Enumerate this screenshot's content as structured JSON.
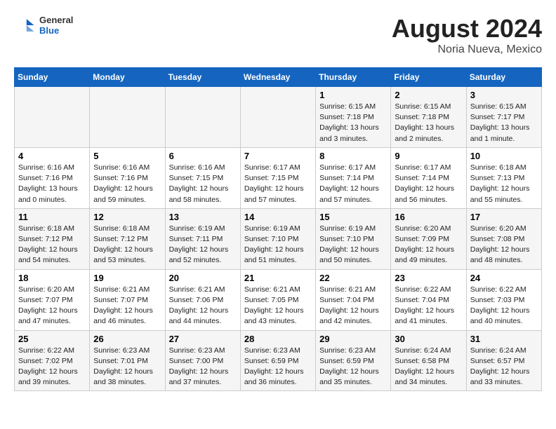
{
  "header": {
    "logo_general": "General",
    "logo_blue": "Blue",
    "title": "August 2024",
    "subtitle": "Noria Nueva, Mexico"
  },
  "weekdays": [
    "Sunday",
    "Monday",
    "Tuesday",
    "Wednesday",
    "Thursday",
    "Friday",
    "Saturday"
  ],
  "weeks": [
    [
      {
        "day": "",
        "content": ""
      },
      {
        "day": "",
        "content": ""
      },
      {
        "day": "",
        "content": ""
      },
      {
        "day": "",
        "content": ""
      },
      {
        "day": "1",
        "content": "Sunrise: 6:15 AM\nSunset: 7:18 PM\nDaylight: 13 hours and 3 minutes."
      },
      {
        "day": "2",
        "content": "Sunrise: 6:15 AM\nSunset: 7:18 PM\nDaylight: 13 hours and 2 minutes."
      },
      {
        "day": "3",
        "content": "Sunrise: 6:15 AM\nSunset: 7:17 PM\nDaylight: 13 hours and 1 minute."
      }
    ],
    [
      {
        "day": "4",
        "content": "Sunrise: 6:16 AM\nSunset: 7:16 PM\nDaylight: 13 hours and 0 minutes."
      },
      {
        "day": "5",
        "content": "Sunrise: 6:16 AM\nSunset: 7:16 PM\nDaylight: 12 hours and 59 minutes."
      },
      {
        "day": "6",
        "content": "Sunrise: 6:16 AM\nSunset: 7:15 PM\nDaylight: 12 hours and 58 minutes."
      },
      {
        "day": "7",
        "content": "Sunrise: 6:17 AM\nSunset: 7:15 PM\nDaylight: 12 hours and 57 minutes."
      },
      {
        "day": "8",
        "content": "Sunrise: 6:17 AM\nSunset: 7:14 PM\nDaylight: 12 hours and 57 minutes."
      },
      {
        "day": "9",
        "content": "Sunrise: 6:17 AM\nSunset: 7:14 PM\nDaylight: 12 hours and 56 minutes."
      },
      {
        "day": "10",
        "content": "Sunrise: 6:18 AM\nSunset: 7:13 PM\nDaylight: 12 hours and 55 minutes."
      }
    ],
    [
      {
        "day": "11",
        "content": "Sunrise: 6:18 AM\nSunset: 7:12 PM\nDaylight: 12 hours and 54 minutes."
      },
      {
        "day": "12",
        "content": "Sunrise: 6:18 AM\nSunset: 7:12 PM\nDaylight: 12 hours and 53 minutes."
      },
      {
        "day": "13",
        "content": "Sunrise: 6:19 AM\nSunset: 7:11 PM\nDaylight: 12 hours and 52 minutes."
      },
      {
        "day": "14",
        "content": "Sunrise: 6:19 AM\nSunset: 7:10 PM\nDaylight: 12 hours and 51 minutes."
      },
      {
        "day": "15",
        "content": "Sunrise: 6:19 AM\nSunset: 7:10 PM\nDaylight: 12 hours and 50 minutes."
      },
      {
        "day": "16",
        "content": "Sunrise: 6:20 AM\nSunset: 7:09 PM\nDaylight: 12 hours and 49 minutes."
      },
      {
        "day": "17",
        "content": "Sunrise: 6:20 AM\nSunset: 7:08 PM\nDaylight: 12 hours and 48 minutes."
      }
    ],
    [
      {
        "day": "18",
        "content": "Sunrise: 6:20 AM\nSunset: 7:07 PM\nDaylight: 12 hours and 47 minutes."
      },
      {
        "day": "19",
        "content": "Sunrise: 6:21 AM\nSunset: 7:07 PM\nDaylight: 12 hours and 46 minutes."
      },
      {
        "day": "20",
        "content": "Sunrise: 6:21 AM\nSunset: 7:06 PM\nDaylight: 12 hours and 44 minutes."
      },
      {
        "day": "21",
        "content": "Sunrise: 6:21 AM\nSunset: 7:05 PM\nDaylight: 12 hours and 43 minutes."
      },
      {
        "day": "22",
        "content": "Sunrise: 6:21 AM\nSunset: 7:04 PM\nDaylight: 12 hours and 42 minutes."
      },
      {
        "day": "23",
        "content": "Sunrise: 6:22 AM\nSunset: 7:04 PM\nDaylight: 12 hours and 41 minutes."
      },
      {
        "day": "24",
        "content": "Sunrise: 6:22 AM\nSunset: 7:03 PM\nDaylight: 12 hours and 40 minutes."
      }
    ],
    [
      {
        "day": "25",
        "content": "Sunrise: 6:22 AM\nSunset: 7:02 PM\nDaylight: 12 hours and 39 minutes."
      },
      {
        "day": "26",
        "content": "Sunrise: 6:23 AM\nSunset: 7:01 PM\nDaylight: 12 hours and 38 minutes."
      },
      {
        "day": "27",
        "content": "Sunrise: 6:23 AM\nSunset: 7:00 PM\nDaylight: 12 hours and 37 minutes."
      },
      {
        "day": "28",
        "content": "Sunrise: 6:23 AM\nSunset: 6:59 PM\nDaylight: 12 hours and 36 minutes."
      },
      {
        "day": "29",
        "content": "Sunrise: 6:23 AM\nSunset: 6:59 PM\nDaylight: 12 hours and 35 minutes."
      },
      {
        "day": "30",
        "content": "Sunrise: 6:24 AM\nSunset: 6:58 PM\nDaylight: 12 hours and 34 minutes."
      },
      {
        "day": "31",
        "content": "Sunrise: 6:24 AM\nSunset: 6:57 PM\nDaylight: 12 hours and 33 minutes."
      }
    ]
  ]
}
